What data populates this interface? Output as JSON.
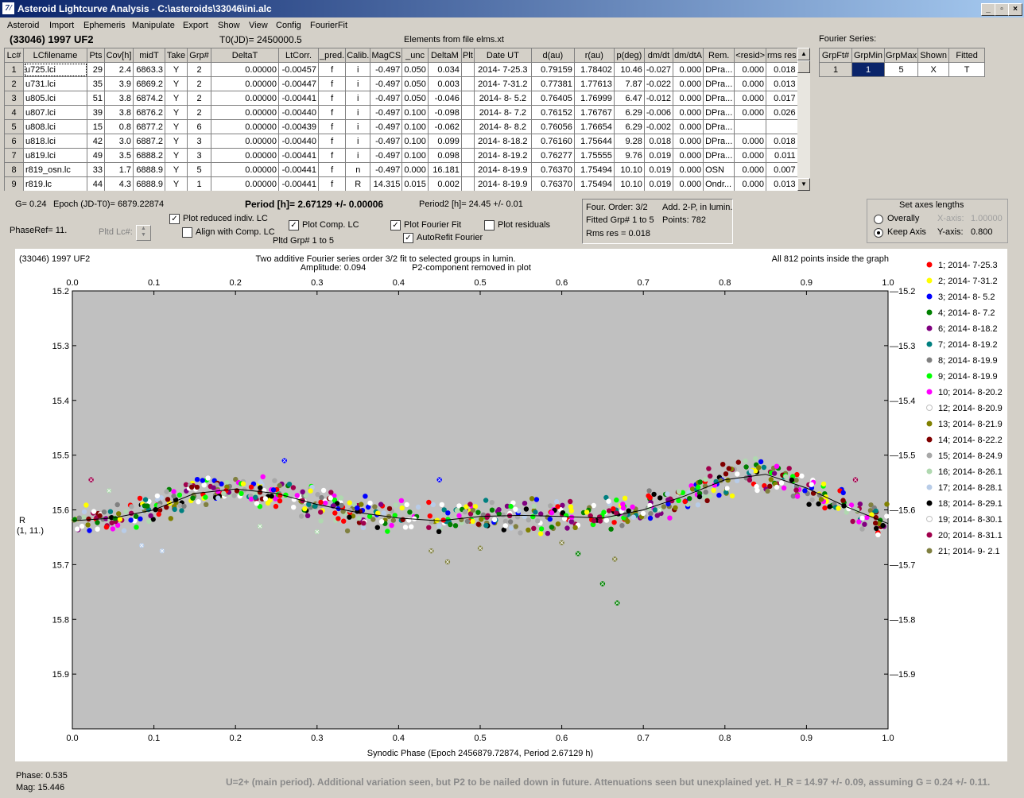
{
  "window": {
    "title": "Asteroid Lightcurve Analysis - C:\\asteroids\\33046\\ini.alc",
    "logo": "7/"
  },
  "menu": [
    "Asteroid",
    "Import",
    "Ephemeris",
    "Manipulate",
    "Export",
    "Show",
    "View",
    "Config",
    "FourierFit"
  ],
  "header": {
    "object": "(33046) 1997 UF2",
    "t0": "T0(JD)= 2450000.5",
    "elements": "Elements from file elms.xt"
  },
  "table": {
    "columns": [
      "Lc#",
      "LCfilename",
      "Pts",
      "Cov[h]",
      "midT",
      "Take",
      "Grp#",
      "DeltaT",
      "LtCorr.",
      "_pred.",
      "Calib.",
      "MagCS",
      "_unc",
      "DeltaM",
      "Plt",
      "Date UT",
      "d(au)",
      "r(au)",
      "p(deg)",
      "dm/dt",
      "dm/dtA",
      "Rem.",
      "<resid>",
      "rms res"
    ],
    "rows": [
      [
        "1",
        "u725.lci",
        "29",
        "2.4",
        "6863.3",
        "Y",
        "2",
        "0.00000",
        "-0.00457",
        "f",
        "i",
        "-0.497",
        "0.050",
        "0.034",
        "",
        "2014- 7-25.3",
        "0.79159",
        "1.78402",
        "10.46",
        "-0.027",
        "0.000",
        "DPra...",
        "0.000",
        "0.018"
      ],
      [
        "2",
        "u731.lci",
        "35",
        "3.9",
        "6869.2",
        "Y",
        "2",
        "0.00000",
        "-0.00447",
        "f",
        "i",
        "-0.497",
        "0.050",
        "0.003",
        "",
        "2014- 7-31.2",
        "0.77381",
        "1.77613",
        "7.87",
        "-0.022",
        "0.000",
        "DPra...",
        "0.000",
        "0.013"
      ],
      [
        "3",
        "u805.lci",
        "51",
        "3.8",
        "6874.2",
        "Y",
        "2",
        "0.00000",
        "-0.00441",
        "f",
        "i",
        "-0.497",
        "0.050",
        "-0.046",
        "",
        "2014- 8- 5.2",
        "0.76405",
        "1.76999",
        "6.47",
        "-0.012",
        "0.000",
        "DPra...",
        "0.000",
        "0.017"
      ],
      [
        "4",
        "u807.lci",
        "39",
        "3.8",
        "6876.2",
        "Y",
        "2",
        "0.00000",
        "-0.00440",
        "f",
        "i",
        "-0.497",
        "0.100",
        "-0.098",
        "",
        "2014- 8- 7.2",
        "0.76152",
        "1.76767",
        "6.29",
        "-0.006",
        "0.000",
        "DPra...",
        "0.000",
        "0.026"
      ],
      [
        "5",
        "u808.lci",
        "15",
        "0.8",
        "6877.2",
        "Y",
        "6",
        "0.00000",
        "-0.00439",
        "f",
        "i",
        "-0.497",
        "0.100",
        "-0.062",
        "",
        "2014- 8- 8.2",
        "0.76056",
        "1.76654",
        "6.29",
        "-0.002",
        "0.000",
        "DPra...",
        "",
        ""
      ],
      [
        "6",
        "u818.lci",
        "42",
        "3.0",
        "6887.2",
        "Y",
        "3",
        "0.00000",
        "-0.00440",
        "f",
        "i",
        "-0.497",
        "0.100",
        "0.099",
        "",
        "2014- 8-18.2",
        "0.76160",
        "1.75644",
        "9.28",
        "0.018",
        "0.000",
        "DPra...",
        "0.000",
        "0.018"
      ],
      [
        "7",
        "u819.lci",
        "49",
        "3.5",
        "6888.2",
        "Y",
        "3",
        "0.00000",
        "-0.00441",
        "f",
        "i",
        "-0.497",
        "0.100",
        "0.098",
        "",
        "2014- 8-19.2",
        "0.76277",
        "1.75555",
        "9.76",
        "0.019",
        "0.000",
        "DPra...",
        "0.000",
        "0.011"
      ],
      [
        "8",
        "r819_osn.lc",
        "33",
        "1.7",
        "6888.9",
        "Y",
        "5",
        "0.00000",
        "-0.00441",
        "f",
        "n",
        "-0.497",
        "0.000",
        "16.181",
        "",
        "2014- 8-19.9",
        "0.76370",
        "1.75494",
        "10.10",
        "0.019",
        "0.000",
        "OSN",
        "0.000",
        "0.007"
      ],
      [
        "9",
        "r819.lc",
        "44",
        "4.3",
        "6888.9",
        "Y",
        "1",
        "0.00000",
        "-0.00441",
        "f",
        "R",
        "14.315",
        "0.015",
        "0.002",
        "",
        "2014- 8-19.9",
        "0.76370",
        "1.75494",
        "10.10",
        "0.019",
        "0.000",
        "Ondr...",
        "0.000",
        "0.013"
      ]
    ]
  },
  "fourier_series": {
    "title": "Fourier Series:",
    "columns": [
      "GrpFt#",
      "GrpMin",
      "GrpMax",
      "Shown",
      "Fitted"
    ],
    "row": [
      "1",
      "1",
      "5",
      "X",
      "T"
    ]
  },
  "info": {
    "g": "G= 0.24",
    "epoch": "Epoch (JD-T0)= 6879.22874",
    "period": "Period [h]= 2.67129 +/- 0.00006",
    "period2": "Period2 [h]= 24.45 +/- 0.01",
    "phaseref": "PhaseRef= 11.",
    "pltd_lc": "Pltd Lc#:",
    "pltd_grp": "Pltd Grp#  1   to   5"
  },
  "checkboxes": {
    "plot_reduced": {
      "label": "Plot reduced indiv. LC",
      "checked": true
    },
    "align_comp": {
      "label": "Align with Comp. LC",
      "checked": false
    },
    "plot_comp": {
      "label": "Plot Comp. LC",
      "checked": true
    },
    "plot_fourier": {
      "label": "Plot Fourier Fit",
      "checked": true
    },
    "autorefit": {
      "label": "AutoRefit Fourier",
      "checked": true
    },
    "plot_residuals": {
      "label": "Plot residuals",
      "checked": false
    }
  },
  "fit_info": {
    "order": "Four. Order:  3/2",
    "add": "Add. 2-P, in lumin.",
    "fitted": "Fitted Grp# 1 to 5",
    "points": "Points: 782",
    "rms": "Rms res    = 0.018"
  },
  "axes": {
    "title": "Set axes lengths",
    "overally": "Overally",
    "keep": "Keep Axis",
    "xaxis_label": "X-axis:",
    "xaxis_val": "1.00000",
    "yaxis_label": "Y-axis:",
    "yaxis_val": "0.800"
  },
  "plot": {
    "object": "(33046) 1997 UF2",
    "subtitle1": "Two additive Fourier series order 3/2 fit to selected groups in lumin.",
    "subtitle2": "Amplitude: 0.094",
    "subtitle3": "P2-component removed in plot",
    "inside": "All 812 points inside the graph",
    "ylabel1": "R",
    "ylabel2": "(1, 11.)",
    "xlabel": "Synodic Phase (Epoch 2456879.72874, Period 2.67129 h)"
  },
  "chart_data": {
    "type": "scatter",
    "xlim": [
      0.0,
      1.0
    ],
    "ylim": [
      15.2,
      16.0
    ],
    "y_inverted": true,
    "x_ticks": [
      "0.0",
      "0.1",
      "0.2",
      "0.3",
      "0.4",
      "0.5",
      "0.6",
      "0.7",
      "0.8",
      "0.9",
      "1.0"
    ],
    "y_ticks": [
      "15.2",
      "15.3",
      "15.4",
      "15.5",
      "15.6",
      "15.7",
      "15.8",
      "15.9"
    ],
    "fit_curve": {
      "x": [
        0.0,
        0.05,
        0.1,
        0.15,
        0.2,
        0.25,
        0.3,
        0.35,
        0.4,
        0.45,
        0.5,
        0.55,
        0.6,
        0.65,
        0.7,
        0.75,
        0.8,
        0.85,
        0.9,
        0.95,
        1.0
      ],
      "y": [
        15.62,
        15.615,
        15.6,
        15.57,
        15.562,
        15.57,
        15.59,
        15.605,
        15.615,
        15.62,
        15.612,
        15.61,
        15.612,
        15.615,
        15.6,
        15.575,
        15.545,
        15.535,
        15.56,
        15.595,
        15.625
      ]
    },
    "series": [
      {
        "name": "1; 2014- 7-25.3",
        "color": "#ff0000"
      },
      {
        "name": "2; 2014- 7-31.2",
        "color": "#ffff00"
      },
      {
        "name": "3; 2014- 8- 5.2",
        "color": "#0000ff"
      },
      {
        "name": "4; 2014- 8- 7.2",
        "color": "#008000"
      },
      {
        "name": "6; 2014- 8-18.2",
        "color": "#800080"
      },
      {
        "name": "7; 2014- 8-19.2",
        "color": "#008080"
      },
      {
        "name": "8; 2014- 8-19.9",
        "color": "#808080"
      },
      {
        "name": "9; 2014- 8-19.9",
        "color": "#00ff00"
      },
      {
        "name": "10; 2014- 8-20.2",
        "color": "#ff00ff"
      },
      {
        "name": "12; 2014- 8-20.9",
        "color": "#ffffff"
      },
      {
        "name": "13; 2014- 8-21.9",
        "color": "#808000"
      },
      {
        "name": "14; 2014- 8-22.2",
        "color": "#800000"
      },
      {
        "name": "15; 2014- 8-24.9",
        "color": "#a8a8a8"
      },
      {
        "name": "16; 2014- 8-26.1",
        "color": "#b0d8b0"
      },
      {
        "name": "17; 2014- 8-28.1",
        "color": "#b8cce8"
      },
      {
        "name": "18; 2014- 8-29.1",
        "color": "#000000"
      },
      {
        "name": "19; 2014- 8-30.1",
        "color": "#ffffff"
      },
      {
        "name": "20; 2014- 8-31.1",
        "color": "#a0004c"
      },
      {
        "name": "21; 2014- 9- 2.1",
        "color": "#808040"
      }
    ],
    "outliers": [
      {
        "x": 0.023,
        "y": 15.545,
        "color": "#a0004c"
      },
      {
        "x": 0.045,
        "y": 15.565,
        "color": "#b0d8b0"
      },
      {
        "x": 0.085,
        "y": 15.665,
        "color": "#b8cce8"
      },
      {
        "x": 0.11,
        "y": 15.675,
        "color": "#b8cce8"
      },
      {
        "x": 0.23,
        "y": 15.63,
        "color": "#b0d8b0"
      },
      {
        "x": 0.26,
        "y": 15.51,
        "color": "#0000ff"
      },
      {
        "x": 0.3,
        "y": 15.64,
        "color": "#b0d8b0"
      },
      {
        "x": 0.44,
        "y": 15.675,
        "color": "#808040"
      },
      {
        "x": 0.45,
        "y": 15.545,
        "color": "#0000ff"
      },
      {
        "x": 0.46,
        "y": 15.695,
        "color": "#808040"
      },
      {
        "x": 0.5,
        "y": 15.67,
        "color": "#808040"
      },
      {
        "x": 0.6,
        "y": 15.66,
        "color": "#808040"
      },
      {
        "x": 0.62,
        "y": 15.68,
        "color": "#008000"
      },
      {
        "x": 0.65,
        "y": 15.735,
        "color": "#008000"
      },
      {
        "x": 0.665,
        "y": 15.69,
        "color": "#808040"
      },
      {
        "x": 0.668,
        "y": 15.77,
        "color": "#008000"
      },
      {
        "x": 0.72,
        "y": 15.6,
        "color": "#b0d8b0"
      },
      {
        "x": 0.96,
        "y": 15.545,
        "color": "#a0004c"
      }
    ]
  },
  "readout": {
    "phase": "Phase:  0.535",
    "mag": "Mag:    15.446"
  },
  "footer": "U=2+ (main period). Additional variation seen, but P2 to be nailed down in future. Attenuations seen but unexplained yet. H_R = 14.97 +/- 0.09, assuming G = 0.24 +/- 0.11."
}
